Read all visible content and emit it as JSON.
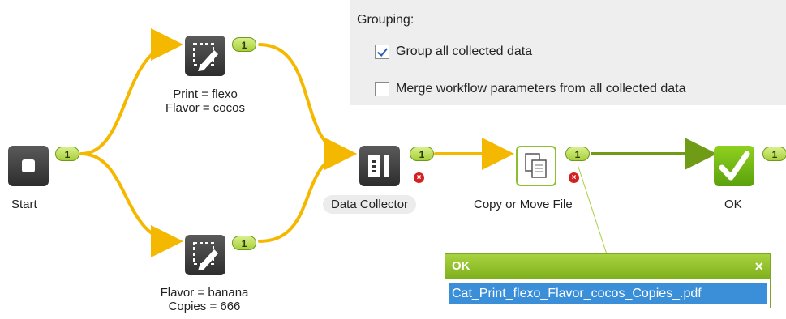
{
  "grouping": {
    "title": "Grouping:",
    "options": [
      {
        "label": "Group all collected data",
        "checked": true
      },
      {
        "label": "Merge workflow parameters from all collected data",
        "checked": false
      }
    ]
  },
  "nodes": {
    "start": {
      "label": "Start",
      "badge": "1"
    },
    "top_form": {
      "label_line1": "Print = flexo",
      "label_line2": "Flavor = cocos",
      "badge": "1"
    },
    "bottom_form": {
      "label_line1": "Flavor = banana",
      "label_line2": "Copies = 666",
      "badge": "1"
    },
    "data_collector": {
      "label": "Data Collector",
      "badge": "1"
    },
    "copy_move": {
      "label": "Copy or Move File",
      "badge": "1"
    },
    "ok": {
      "label": "OK",
      "badge": "1"
    }
  },
  "popup": {
    "title": "OK",
    "close": "×",
    "file": "Cat_Print_flexo_Flavor_cocos_Copies_.pdf"
  },
  "colors": {
    "connector_yellow": "#f5b800",
    "connector_green": "#6f9b16",
    "accent_green": "#8cbf2f",
    "selection_blue": "#3a8fd8"
  },
  "icons": {
    "start": "stop-square-icon",
    "form": "pencil-form-icon",
    "collector": "data-collector-icon",
    "copy": "copy-files-icon",
    "ok": "checkmark-icon",
    "error": "error-x-icon"
  }
}
